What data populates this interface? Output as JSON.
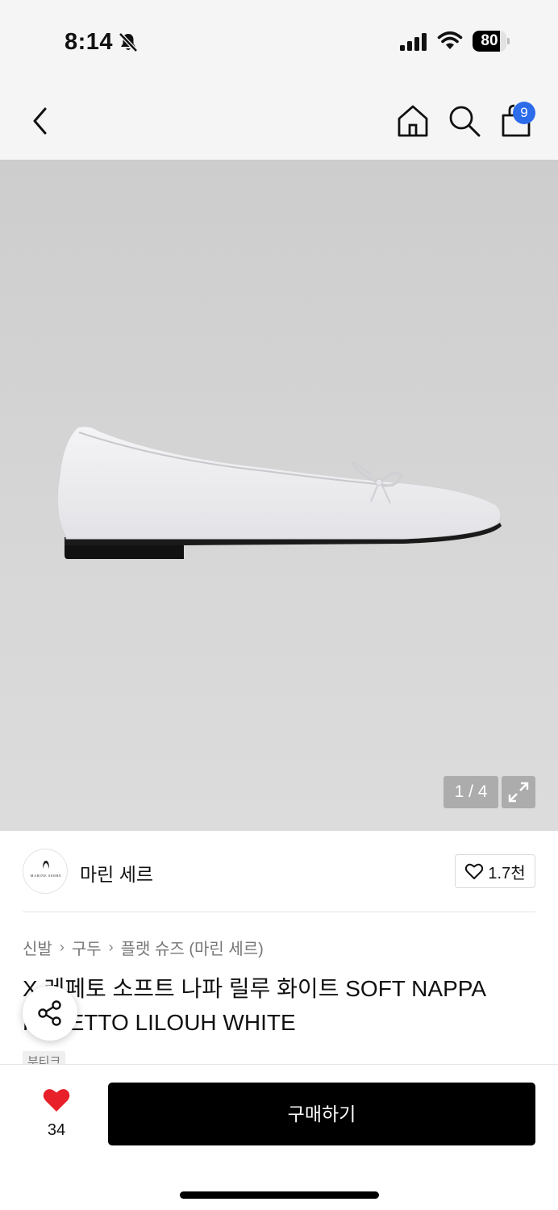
{
  "status_bar": {
    "time": "8:14",
    "battery": "80",
    "battery_level": 0.8
  },
  "nav": {
    "icons": [
      "chevron-left-icon",
      "home-icon",
      "search-icon",
      "shopping-bag-icon"
    ],
    "cart_count": "9"
  },
  "gallery": {
    "counter": "1 / 4"
  },
  "brand": {
    "name": "마린 세르",
    "logo_text": "MARINE SERRE",
    "like_count": "1.7천"
  },
  "breadcrumb": [
    "신발",
    "구두",
    "플랫 슈즈 (마린 세르)"
  ],
  "product": {
    "title": "X 레페토 소프트 나파 릴루 화이트 SOFT NAPPA REPETTO LILOUH WHITE",
    "tag": "부티크"
  },
  "bottom_bar": {
    "wish_count": "34",
    "buy_label": "구매하기"
  },
  "colors": {
    "accent_badge": "#2c6bea",
    "heart": "#e8202a",
    "buy_button": "#000000"
  }
}
